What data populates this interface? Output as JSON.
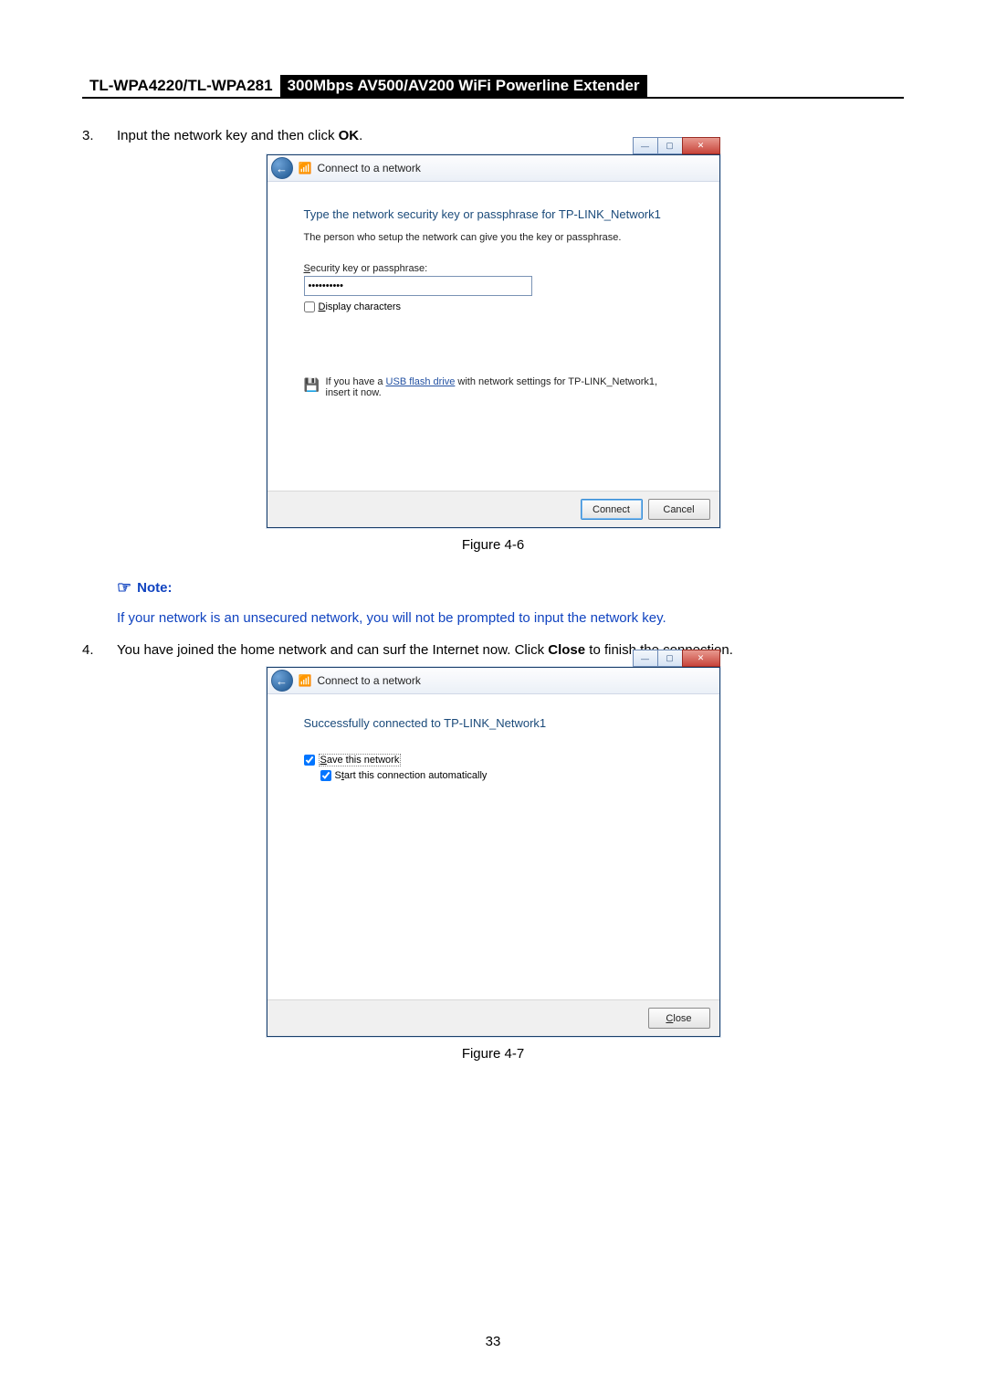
{
  "header": {
    "model": "TL-WPA4220/TL-WPA281",
    "title": "300Mbps AV500/AV200 WiFi Powerline Extender"
  },
  "step3": {
    "num": "3.",
    "text_pre": "Input the network key and then click ",
    "text_bold": "OK",
    "text_post": "."
  },
  "dlg1": {
    "top_title": "Connect to a network",
    "heading": "Type the network security key or passphrase for TP-LINK_Network1",
    "sub": "The person who setup the network can give you the key or passphrase.",
    "label": "Security key or passphrase:",
    "input_value": "••••••••••",
    "chk_label": "Display characters",
    "chk_underline": "D",
    "usb_pre": "If you have a ",
    "usb_link": "USB flash drive",
    "usb_post": " with network settings for TP-LINK_Network1, insert it now.",
    "btn_connect": "Connect",
    "btn_cancel": "Cancel"
  },
  "fig1": "Figure 4-6",
  "note": {
    "label": "Note:",
    "text": "If your network is an unsecured network, you will not be prompted to input the network key."
  },
  "step4": {
    "num": "4.",
    "text_a": "You  have  joined  the  home  network  and  can  surf  the  Internet  now.  Click ",
    "text_bold": "Close",
    "text_b": " to  finish  the connection."
  },
  "dlg2": {
    "top_title": "Connect to a network",
    "heading": "Successfully connected to TP-LINK_Network1",
    "save_u": "S",
    "save_label": "ave this network",
    "start_u": "t",
    "start_pre": "S",
    "start_label": "art this connection automatically",
    "btn_close": "Close",
    "btn_close_u": "C"
  },
  "fig2": "Figure 4-7",
  "page_number": "33"
}
